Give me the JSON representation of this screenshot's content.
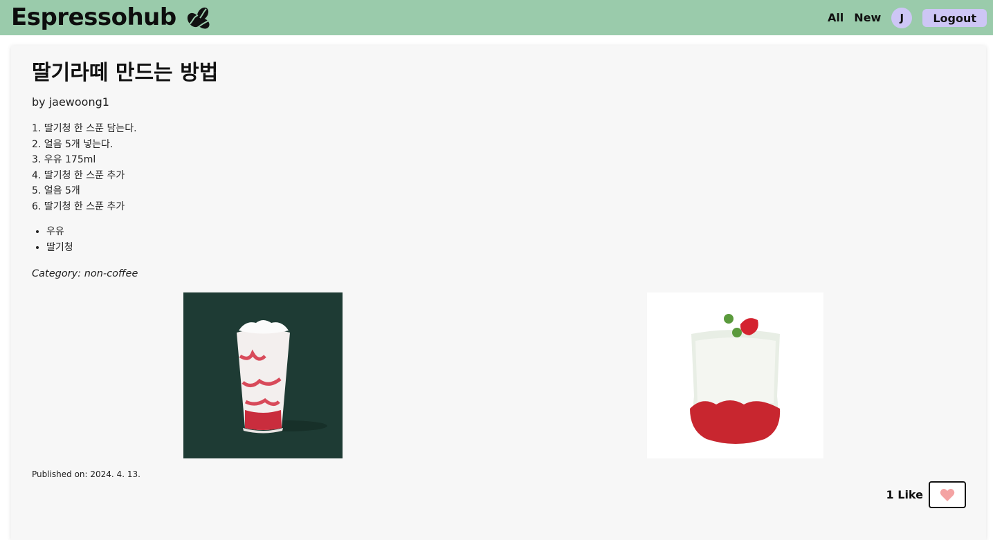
{
  "header": {
    "brand": "Espressohub",
    "logo_icon": "coffee-beans-icon",
    "nav": {
      "all_label": "All",
      "new_label": "New"
    },
    "user_initial": "J",
    "logout_label": "Logout"
  },
  "post": {
    "title": "딸기라떼 만드는 방법",
    "author_line": "by jaewoong1",
    "steps": [
      "1. 딸기청 한 스푼 담는다.",
      "2. 얼음 5개 넣는다.",
      "3. 우유 175ml",
      "4. 딸기청 한 스푼 추가",
      "5. 얼음 5개",
      "6. 딸기청 한 스푼 추가"
    ],
    "ingredients": [
      "우유",
      "딸기청"
    ],
    "category_line": "Category: non-coffee",
    "images": [
      {
        "name": "strawberry-latte-photo-dark",
        "background": "#1e3b34"
      },
      {
        "name": "strawberry-latte-photo-white",
        "background": "#ffffff"
      }
    ],
    "published_line": "Published on: 2024. 4. 13.",
    "likes_label": "1 Like",
    "like_icon": "heart-icon"
  },
  "colors": {
    "header_bg": "#9acbab",
    "accent_purple": "#cdc6f5",
    "card_bg": "#f7f7f7",
    "heart": "#f4a3a3"
  }
}
